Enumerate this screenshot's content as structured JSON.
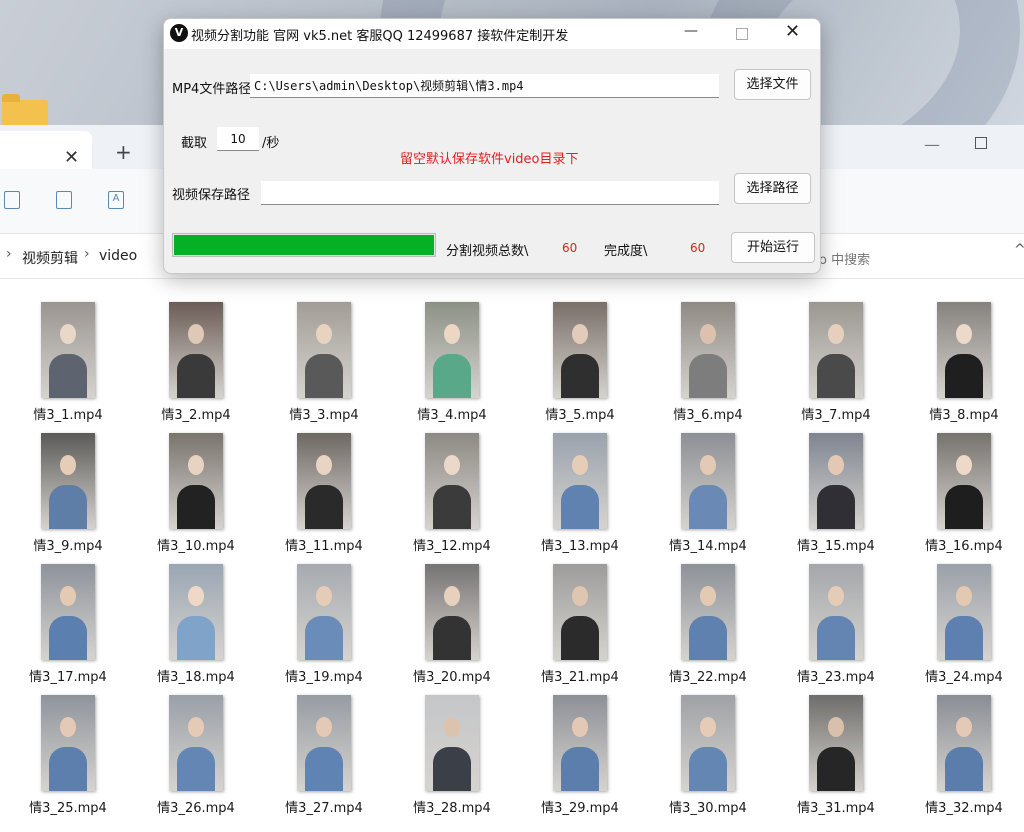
{
  "dialog": {
    "title": "视频分割功能 官网 vk5.net 客服QQ 12499687 接软件定制开发",
    "mp4_path_label": "MP4文件路径",
    "mp4_path_value": "C:\\Users\\admin\\Desktop\\视频剪辑\\情3.mp4",
    "choose_file_label": "选择文件",
    "clip_label": "截取",
    "clip_value": "10",
    "clip_unit": "/秒",
    "hint_text": "留空默认保存软件video目录下",
    "save_path_label": "视频保存路径",
    "save_path_value": "",
    "choose_path_label": "选择路径",
    "progress_fraction": 1.0,
    "total_label": "分割视频总数\\",
    "total_value": "60",
    "done_label": "完成度\\",
    "done_value": "60",
    "start_label": "开始运行",
    "colors": {
      "progress": "#06b025",
      "hint": "#e02020"
    }
  },
  "explorer": {
    "breadcrumb": [
      "视频剪辑",
      "video"
    ],
    "search_placeholder": "eo 中搜索",
    "files": [
      "情3_1.mp4",
      "情3_2.mp4",
      "情3_3.mp4",
      "情3_4.mp4",
      "情3_5.mp4",
      "情3_6.mp4",
      "情3_7.mp4",
      "情3_8.mp4",
      "情3_9.mp4",
      "情3_10.mp4",
      "情3_11.mp4",
      "情3_12.mp4",
      "情3_13.mp4",
      "情3_14.mp4",
      "情3_15.mp4",
      "情3_16.mp4",
      "情3_17.mp4",
      "情3_18.mp4",
      "情3_19.mp4",
      "情3_20.mp4",
      "情3_21.mp4",
      "情3_22.mp4",
      "情3_23.mp4",
      "情3_24.mp4",
      "情3_25.mp4",
      "情3_26.mp4",
      "情3_27.mp4",
      "情3_28.mp4",
      "情3_29.mp4",
      "情3_30.mp4",
      "情3_31.mp4",
      "情3_32.mp4"
    ]
  }
}
